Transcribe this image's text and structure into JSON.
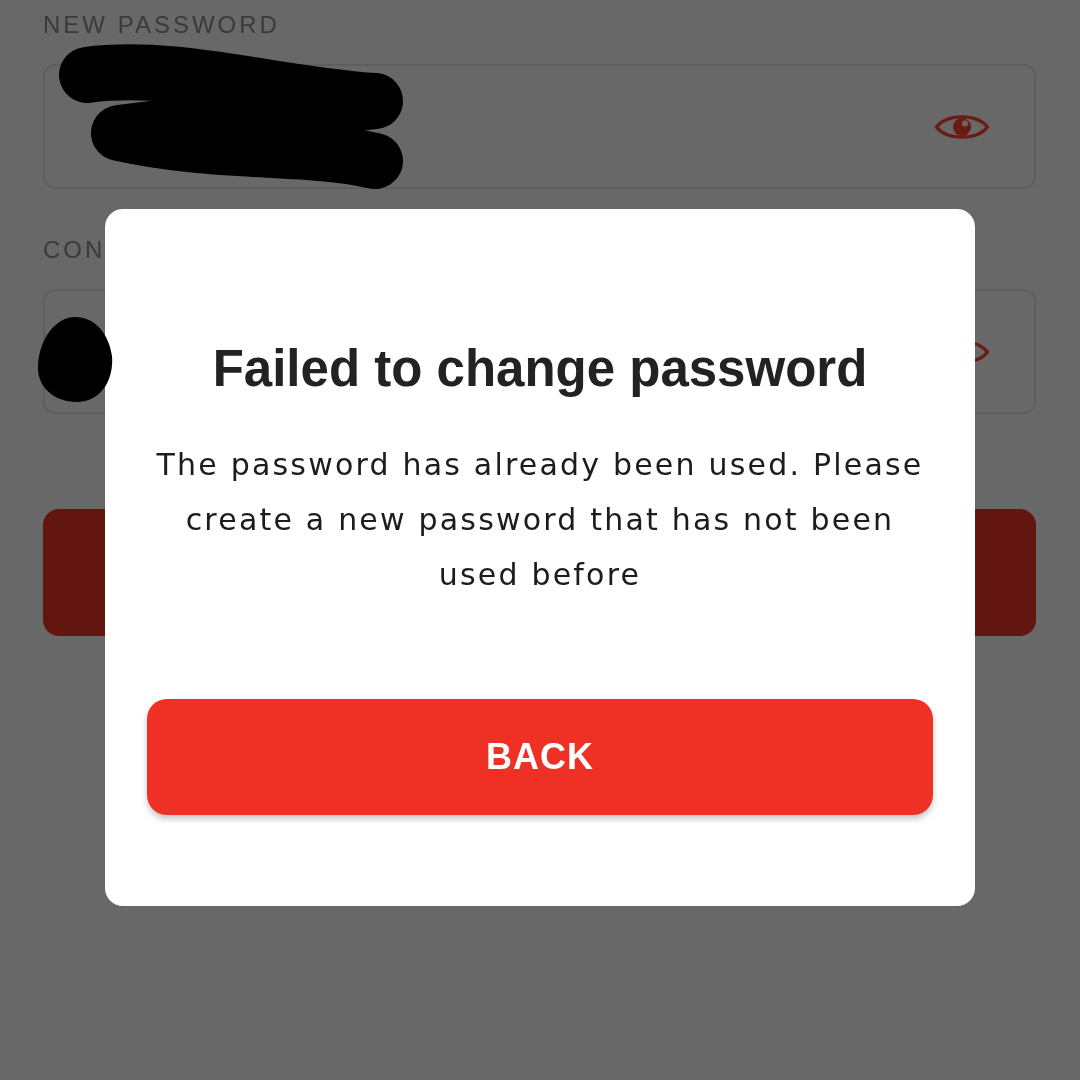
{
  "form": {
    "fields": [
      {
        "label": "NEW PASSWORD",
        "redacted": true
      },
      {
        "label": "CON",
        "redacted": true
      }
    ]
  },
  "dialog": {
    "title": "Failed to change password",
    "message": "The password has already been used. Please create a new password that has not been used before",
    "button": "BACK"
  }
}
